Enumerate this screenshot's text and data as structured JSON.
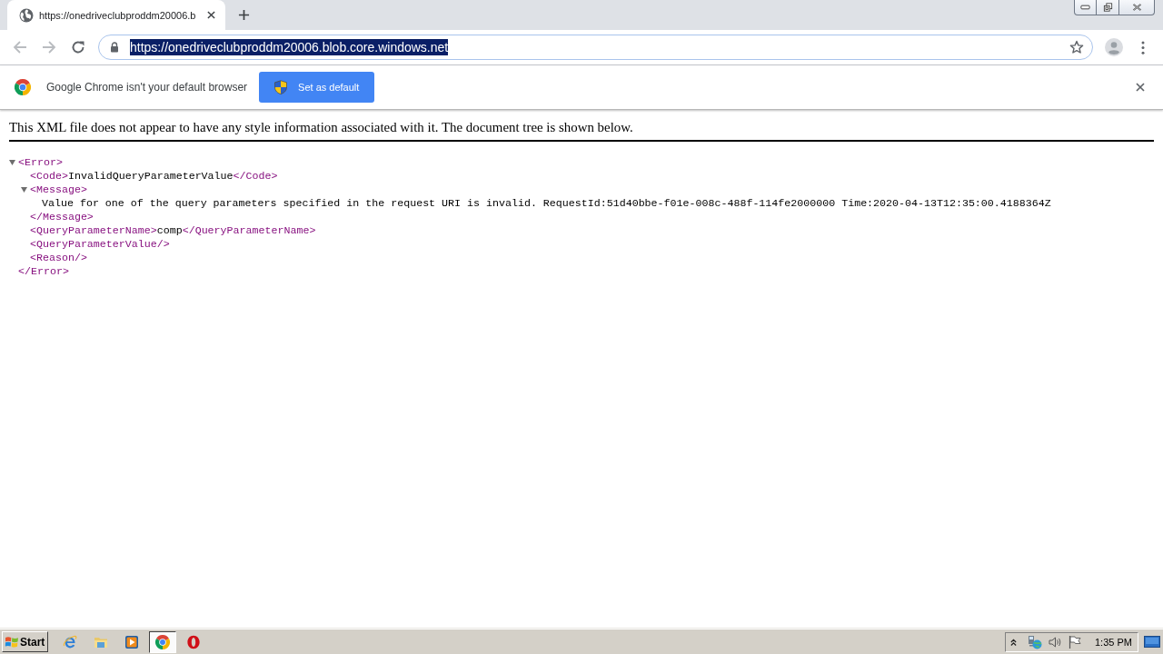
{
  "browser": {
    "tabs": [
      {
        "title": "https://onedriveclubproddm20006.b",
        "selected": true
      }
    ],
    "nav_buttons": [
      {
        "kind": "back",
        "disabled": true
      },
      {
        "kind": "forward",
        "disabled": true
      },
      {
        "kind": "reload",
        "disabled": false
      }
    ],
    "address_bar": {
      "url": "https://onedriveclubproddm20006.blob.core.windows.net",
      "selected": true
    },
    "infobar": {
      "message": "Google Chrome isn't your default browser",
      "button": "Set as default"
    }
  },
  "page": {
    "notice": "This XML file does not appear to have any style information associated with it. The document tree is shown below.",
    "xml_tree": [
      {
        "kind": "element",
        "open": "<Error>",
        "close": "</Error>",
        "expanded": true,
        "children": [
          {
            "kind": "inline",
            "open": "<Code>",
            "text": "InvalidQueryParameterValue",
            "close": "</Code>"
          },
          {
            "kind": "element",
            "open": "<Message>",
            "close": "</Message>",
            "expanded": true,
            "children": [
              {
                "kind": "text",
                "text": "Value for one of the query parameters specified in the request URI is invalid. RequestId:51d40bbe-f01e-008c-488f-114fe2000000 Time:2020-04-13T12:35:00.4188364Z"
              }
            ]
          },
          {
            "kind": "inline",
            "open": "<QueryParameterName>",
            "text": "comp",
            "close": "</QueryParameterName>"
          },
          {
            "kind": "empty",
            "tag": "<QueryParameterValue/>"
          },
          {
            "kind": "empty",
            "tag": "<Reason/>"
          }
        ]
      }
    ]
  },
  "taskbar": {
    "start": "Start",
    "apps": [
      {
        "kind": "ie",
        "selected": false
      },
      {
        "kind": "folder",
        "selected": false
      },
      {
        "kind": "media",
        "selected": false
      },
      {
        "kind": "chrome",
        "selected": true
      },
      {
        "kind": "opera",
        "selected": false
      }
    ],
    "clock": "1:35 PM"
  }
}
